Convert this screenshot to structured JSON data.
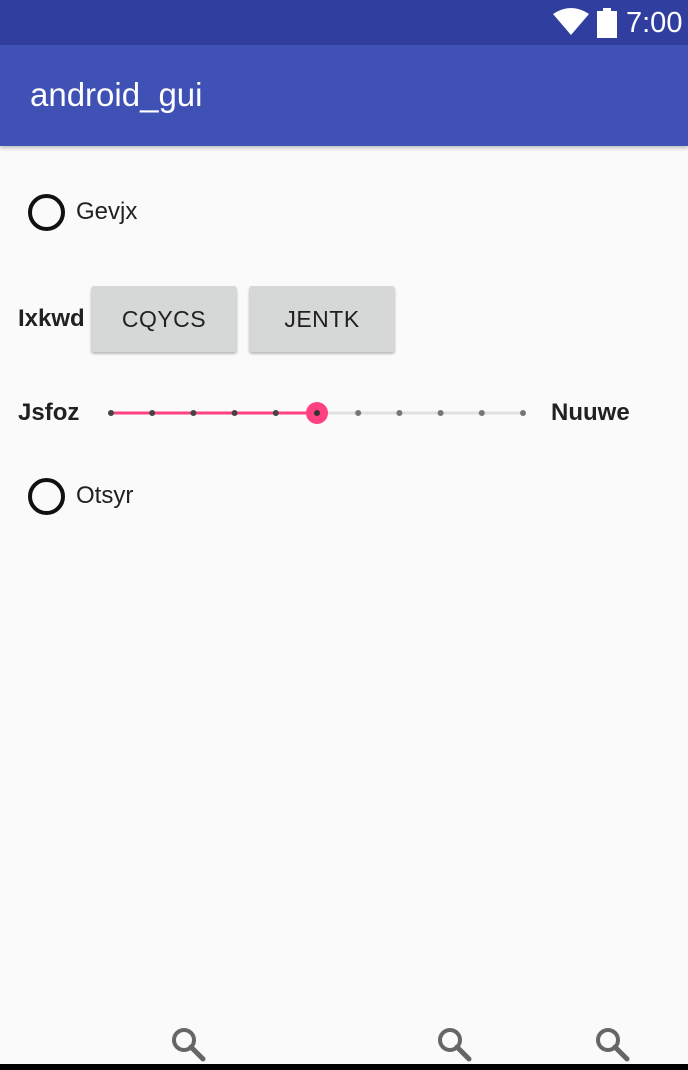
{
  "status_bar": {
    "time": "7:00",
    "wifi_icon": "wifi-icon",
    "battery_icon": "battery-icon"
  },
  "app_bar": {
    "title": "android_gui"
  },
  "radio_1": {
    "label": "Gevjx",
    "checked": false
  },
  "button_row": {
    "label": "Ixkwd",
    "button_1": "CQYCS",
    "button_2": "JENTK"
  },
  "slider": {
    "left_label": "Jsfoz",
    "right_label": "Nuuwe",
    "min": 0,
    "max": 10,
    "value": 5,
    "accent": "#ff4081"
  },
  "radio_2": {
    "label": "Otsyr",
    "checked": false
  },
  "bottom_icons": [
    "search-icon",
    "search-icon",
    "search-icon"
  ]
}
